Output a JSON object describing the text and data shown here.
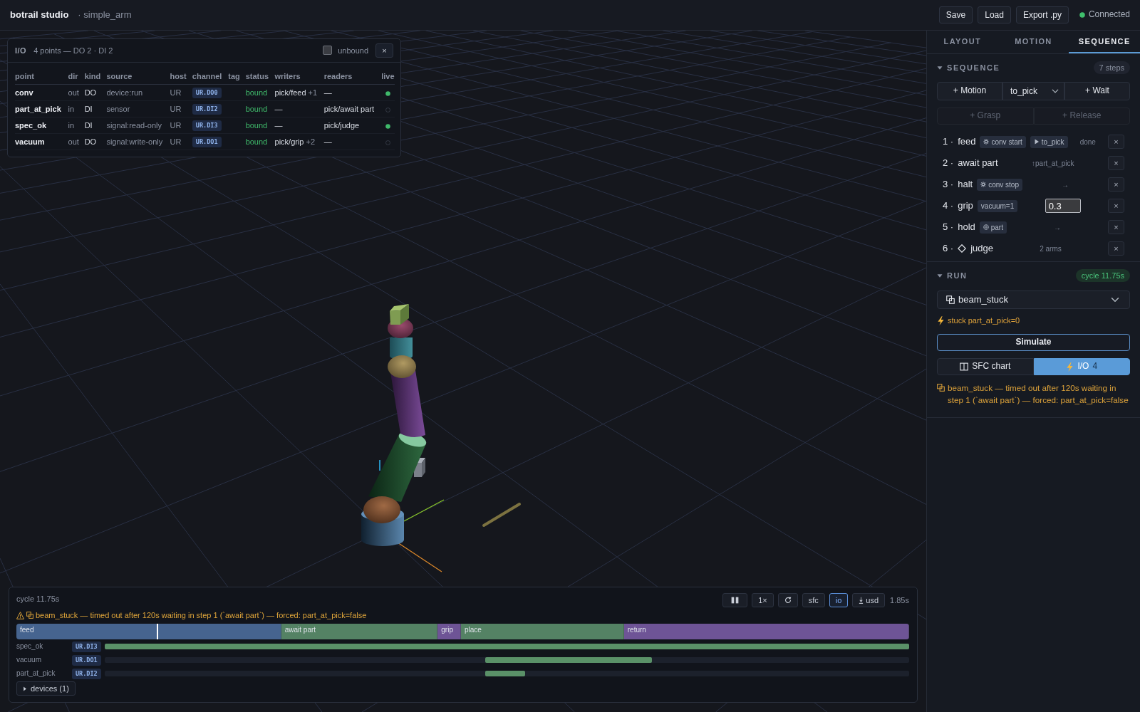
{
  "header": {
    "title": "botrail studio",
    "project": "· simple_arm",
    "actions": [
      "Save",
      "Load",
      "Export .py"
    ],
    "connection": {
      "label": "Connected",
      "connected": true
    }
  },
  "io_panel": {
    "title": "I/O",
    "summary": "4 points — DO 2 · DI 2",
    "unbound_filter": {
      "label": "unbound",
      "checked": false
    },
    "close": "×",
    "columns": [
      "point",
      "dir",
      "kind",
      "source",
      "host",
      "channel",
      "tag",
      "status",
      "writers",
      "readers",
      "live"
    ],
    "rows": [
      {
        "point": "conv",
        "dir": "out",
        "kind": "DO",
        "source": "device:run",
        "host": "UR",
        "channel": "UR.DO0",
        "status": "bound",
        "writers": "pick/feed",
        "writers_more": "+1",
        "readers": "—",
        "live": true
      },
      {
        "point": "part_at_pick",
        "dir": "in",
        "kind": "DI",
        "source": "sensor",
        "host": "UR",
        "channel": "UR.DI2",
        "status": "bound",
        "writers": "—",
        "readers": "pick/await part",
        "live": false
      },
      {
        "point": "spec_ok",
        "dir": "in",
        "kind": "DI",
        "source": "signal:read-only",
        "host": "UR",
        "channel": "UR.DI3",
        "status": "bound",
        "writers": "—",
        "readers": "pick/judge",
        "live": true
      },
      {
        "point": "vacuum",
        "dir": "out",
        "kind": "DO",
        "source": "signal:write-only",
        "host": "UR",
        "channel": "UR.DO1",
        "status": "bound",
        "writers": "pick/grip",
        "writers_more": "+2",
        "readers": "—",
        "live": false
      }
    ]
  },
  "timeline": {
    "cycle": "cycle 11.75s",
    "controls": [
      {
        "kind": "pause",
        "selected": false
      },
      {
        "kind": "speed",
        "label": "1×",
        "selected": false
      },
      {
        "kind": "loop",
        "selected": false
      },
      {
        "kind": "sfc",
        "label": "sfc",
        "selected": false
      },
      {
        "kind": "io",
        "label": "io",
        "selected": true
      },
      {
        "kind": "download",
        "label": "usd",
        "selected": false
      }
    ],
    "time": "1.85s",
    "warning": "beam_stuck — timed out after 120s waiting in step 1 (`await part`) — forced: part_at_pick=false",
    "phases": [
      {
        "label": "feed",
        "color": "#46648f"
      },
      {
        "label": "await part",
        "color": "#548264"
      },
      {
        "label": "grip",
        "color": "#6e5496"
      },
      {
        "label": "place",
        "color": "#548264"
      },
      {
        "label": "return",
        "color": "#6e5496"
      }
    ],
    "playhead": {
      "level": 0.157
    },
    "signals": [
      {
        "name": "spec_ok",
        "channel": "UR.DI3"
      },
      {
        "name": "vacuum",
        "channel": "UR.DO1"
      },
      {
        "name": "part_at_pick",
        "channel": "UR.DI2"
      }
    ],
    "devices": {
      "label": "devices (1)",
      "expanded": false
    }
  },
  "sidebar": {
    "tabs": [
      {
        "label": "LAYOUT",
        "selected": false
      },
      {
        "label": "MOTION",
        "selected": false
      },
      {
        "label": "SEQUENCE",
        "selected": true
      }
    ],
    "sequence": {
      "title": "SEQUENCE",
      "expanded": true,
      "count": "7 steps",
      "add_motion": "+ Motion",
      "motion_target": "to_pick",
      "add_wait": "+ Wait",
      "add_grasp": {
        "label": "+ Grasp",
        "disabled": true
      },
      "add_release": {
        "label": "+ Release",
        "disabled": true
      },
      "steps": [
        {
          "index": "1 ·",
          "name": "feed",
          "tags": [
            {
              "kind": "device",
              "label": "conv start"
            },
            {
              "kind": "motion",
              "label": "to_pick"
            }
          ],
          "detail": {
            "kind": "text",
            "text": "done"
          },
          "remove": "×"
        },
        {
          "index": "2 ·",
          "name": "await part",
          "detail": {
            "kind": "text",
            "text": "↑part_at_pick"
          },
          "remove": "×"
        },
        {
          "index": "3 ·",
          "name": "halt",
          "tags": [
            {
              "kind": "device",
              "label": "conv stop"
            }
          ],
          "detail": {
            "kind": "text",
            "text": "→"
          },
          "remove": "×"
        },
        {
          "index": "4 ·",
          "name": "grip",
          "tags": [
            {
              "kind": "set",
              "label": "vacuum=1"
            }
          ],
          "detail": {
            "kind": "input",
            "value": "0.3"
          },
          "remove": "×"
        },
        {
          "index": "5 ·",
          "name": "hold",
          "tags": [
            {
              "kind": "attach",
              "label": "part"
            }
          ],
          "detail": {
            "kind": "text",
            "text": "→"
          },
          "remove": "×"
        },
        {
          "index": "6 ·",
          "kind": "branch",
          "name": "judge",
          "detail": {
            "kind": "text",
            "text": "2 arms"
          },
          "remove": "×"
        }
      ]
    },
    "run": {
      "title": "RUN",
      "expanded": true,
      "cycle": "cycle 11.75s",
      "scenario": "beam_stuck",
      "fault": "stuck part_at_pick=0",
      "simulate": "Simulate",
      "views": [
        {
          "kind": "sfc",
          "label": "SFC chart",
          "selected": false
        },
        {
          "kind": "io",
          "label": "I/O",
          "count": "4",
          "selected": true
        }
      ],
      "message": "beam_stuck — timed out after 120s waiting in step 1 (`await part`) — forced: part_at_pick=false"
    }
  }
}
